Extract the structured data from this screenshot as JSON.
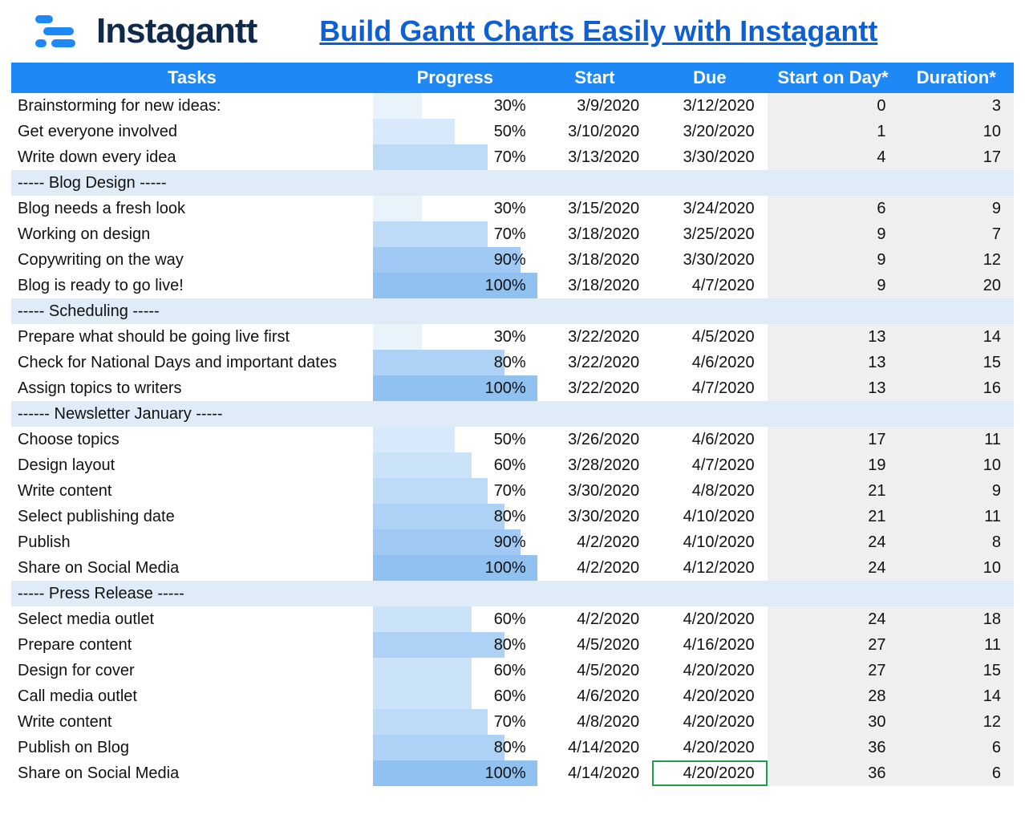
{
  "header": {
    "brand": "Instagantt",
    "title_link": "Build Gantt Charts Easily with Instagantt"
  },
  "columns": {
    "tasks": "Tasks",
    "progress": "Progress",
    "start": "Start",
    "due": "Due",
    "start_on_day": "Start on Day*",
    "duration": "Duration*"
  },
  "colors": {
    "progress_shades": {
      "30": "#E9F3FC",
      "50": "#D7E9FA",
      "60": "#CBE3F9",
      "70": "#BDDBF7",
      "80": "#AED2F5",
      "90": "#A0CAF3",
      "100": "#91C1F1"
    }
  },
  "rows": [
    {
      "type": "task",
      "task": "Brainstorming for new ideas:",
      "progress": 30,
      "start": "3/9/2020",
      "due": "3/12/2020",
      "sod": 0,
      "dur": 3
    },
    {
      "type": "task",
      "task": "Get everyone involved",
      "progress": 50,
      "start": "3/10/2020",
      "due": "3/20/2020",
      "sod": 1,
      "dur": 10
    },
    {
      "type": "task",
      "task": "Write down every idea",
      "progress": 70,
      "start": "3/13/2020",
      "due": "3/30/2020",
      "sod": 4,
      "dur": 17
    },
    {
      "type": "section",
      "label": "----- Blog Design -----"
    },
    {
      "type": "task",
      "task": "Blog needs a fresh look",
      "progress": 30,
      "start": "3/15/2020",
      "due": "3/24/2020",
      "sod": 6,
      "dur": 9
    },
    {
      "type": "task",
      "task": "Working on design",
      "progress": 70,
      "start": "3/18/2020",
      "due": "3/25/2020",
      "sod": 9,
      "dur": 7
    },
    {
      "type": "task",
      "task": "Copywriting on the way",
      "progress": 90,
      "start": "3/18/2020",
      "due": "3/30/2020",
      "sod": 9,
      "dur": 12
    },
    {
      "type": "task",
      "task": "Blog is ready to go live!",
      "progress": 100,
      "start": "3/18/2020",
      "due": "4/7/2020",
      "sod": 9,
      "dur": 20
    },
    {
      "type": "section",
      "label": "----- Scheduling -----"
    },
    {
      "type": "task",
      "task": "Prepare what should be going live first",
      "progress": 30,
      "start": "3/22/2020",
      "due": "4/5/2020",
      "sod": 13,
      "dur": 14
    },
    {
      "type": "task",
      "task": "Check for National Days and important dates",
      "progress": 80,
      "start": "3/22/2020",
      "due": "4/6/2020",
      "sod": 13,
      "dur": 15
    },
    {
      "type": "task",
      "task": "Assign topics to writers",
      "progress": 100,
      "start": "3/22/2020",
      "due": "4/7/2020",
      "sod": 13,
      "dur": 16
    },
    {
      "type": "section",
      "label": "------ Newsletter January -----"
    },
    {
      "type": "task",
      "task": "Choose topics",
      "progress": 50,
      "start": "3/26/2020",
      "due": "4/6/2020",
      "sod": 17,
      "dur": 11
    },
    {
      "type": "task",
      "task": "Design layout",
      "progress": 60,
      "start": "3/28/2020",
      "due": "4/7/2020",
      "sod": 19,
      "dur": 10
    },
    {
      "type": "task",
      "task": "Write content",
      "progress": 70,
      "start": "3/30/2020",
      "due": "4/8/2020",
      "sod": 21,
      "dur": 9
    },
    {
      "type": "task",
      "task": "Select publishing date",
      "progress": 80,
      "start": "3/30/2020",
      "due": "4/10/2020",
      "sod": 21,
      "dur": 11
    },
    {
      "type": "task",
      "task": "Publish",
      "progress": 90,
      "start": "4/2/2020",
      "due": "4/10/2020",
      "sod": 24,
      "dur": 8
    },
    {
      "type": "task",
      "task": "Share on Social Media",
      "progress": 100,
      "start": "4/2/2020",
      "due": "4/12/2020",
      "sod": 24,
      "dur": 10
    },
    {
      "type": "section",
      "label": "----- Press Release -----"
    },
    {
      "type": "task",
      "task": "Select media outlet",
      "progress": 60,
      "start": "4/2/2020",
      "due": "4/20/2020",
      "sod": 24,
      "dur": 18
    },
    {
      "type": "task",
      "task": "Prepare content",
      "progress": 80,
      "start": "4/5/2020",
      "due": "4/16/2020",
      "sod": 27,
      "dur": 11
    },
    {
      "type": "task",
      "task": "Design for cover",
      "progress": 60,
      "start": "4/5/2020",
      "due": "4/20/2020",
      "sod": 27,
      "dur": 15
    },
    {
      "type": "task",
      "task": "Call media outlet",
      "progress": 60,
      "start": "4/6/2020",
      "due": "4/20/2020",
      "sod": 28,
      "dur": 14
    },
    {
      "type": "task",
      "task": "Write content",
      "progress": 70,
      "start": "4/8/2020",
      "due": "4/20/2020",
      "sod": 30,
      "dur": 12
    },
    {
      "type": "task",
      "task": "Publish on Blog",
      "progress": 80,
      "start": "4/14/2020",
      "due": "4/20/2020",
      "sod": 36,
      "dur": 6
    },
    {
      "type": "task",
      "task": "Share on Social Media",
      "progress": 100,
      "start": "4/14/2020",
      "due": "4/20/2020",
      "sod": 36,
      "dur": 6,
      "due_selected": true
    }
  ],
  "chart_data": {
    "type": "table",
    "title": "Build Gantt Charts Easily with Instagantt",
    "columns": [
      "Tasks",
      "Progress",
      "Start",
      "Due",
      "Start on Day*",
      "Duration*"
    ],
    "series": [
      {
        "name": "Progress",
        "unit": "%",
        "values": [
          30,
          50,
          70,
          30,
          70,
          90,
          100,
          30,
          80,
          100,
          50,
          60,
          70,
          80,
          90,
          100,
          60,
          80,
          60,
          60,
          70,
          80,
          100
        ]
      }
    ],
    "categories": [
      "Brainstorming for new ideas:",
      "Get everyone involved",
      "Write down every idea",
      "Blog needs a fresh look",
      "Working on design",
      "Copywriting on the way",
      "Blog is ready to go live!",
      "Prepare what should be going live first",
      "Check for National Days and important dates",
      "Assign topics to writers",
      "Choose topics",
      "Design layout",
      "Write content",
      "Select publishing date",
      "Publish",
      "Share on Social Media",
      "Select media outlet",
      "Prepare content",
      "Design for cover",
      "Call media outlet",
      "Write content",
      "Publish on Blog",
      "Share on Social Media"
    ],
    "start": [
      "3/9/2020",
      "3/10/2020",
      "3/13/2020",
      "3/15/2020",
      "3/18/2020",
      "3/18/2020",
      "3/18/2020",
      "3/22/2020",
      "3/22/2020",
      "3/22/2020",
      "3/26/2020",
      "3/28/2020",
      "3/30/2020",
      "3/30/2020",
      "4/2/2020",
      "4/2/2020",
      "4/2/2020",
      "4/5/2020",
      "4/5/2020",
      "4/6/2020",
      "4/8/2020",
      "4/14/2020",
      "4/14/2020"
    ],
    "due": [
      "3/12/2020",
      "3/20/2020",
      "3/30/2020",
      "3/24/2020",
      "3/25/2020",
      "3/30/2020",
      "4/7/2020",
      "4/5/2020",
      "4/6/2020",
      "4/7/2020",
      "4/6/2020",
      "4/7/2020",
      "4/8/2020",
      "4/10/2020",
      "4/10/2020",
      "4/12/2020",
      "4/20/2020",
      "4/16/2020",
      "4/20/2020",
      "4/20/2020",
      "4/20/2020",
      "4/20/2020",
      "4/20/2020"
    ],
    "start_on_day": [
      0,
      1,
      4,
      6,
      9,
      9,
      9,
      13,
      13,
      13,
      17,
      19,
      21,
      21,
      24,
      24,
      24,
      27,
      27,
      28,
      30,
      36,
      36
    ],
    "duration": [
      3,
      10,
      17,
      9,
      7,
      12,
      20,
      14,
      15,
      16,
      11,
      10,
      9,
      11,
      8,
      10,
      18,
      11,
      15,
      14,
      12,
      6,
      6
    ]
  }
}
